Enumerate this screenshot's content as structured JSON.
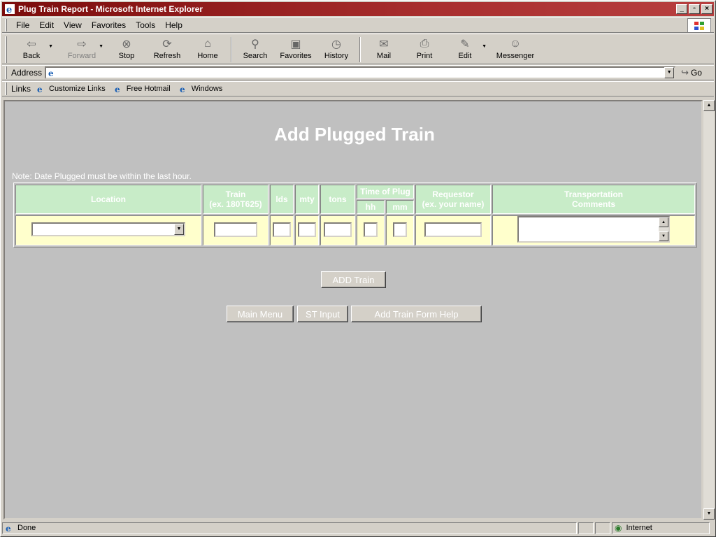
{
  "window": {
    "title": "Plug Train Report - Microsoft Internet Explorer",
    "minimize": "_",
    "maximize": "▫",
    "close": "×"
  },
  "menu": {
    "items": [
      {
        "label": "File"
      },
      {
        "label": "Edit"
      },
      {
        "label": "View"
      },
      {
        "label": "Favorites"
      },
      {
        "label": "Tools"
      },
      {
        "label": "Help"
      }
    ]
  },
  "toolbar": {
    "back": "Back",
    "forward": "Forward",
    "stop": "Stop",
    "refresh": "Refresh",
    "home": "Home",
    "search": "Search",
    "favorites": "Favorites",
    "history": "History",
    "mail": "Mail",
    "print": "Print",
    "edit": "Edit",
    "messenger": "Messenger"
  },
  "address": {
    "label": "Address",
    "value": "",
    "go": "Go"
  },
  "links": {
    "label": "Links",
    "items": [
      {
        "label": "Customize Links"
      },
      {
        "label": "Free Hotmail"
      },
      {
        "label": "Windows"
      }
    ]
  },
  "page": {
    "title": "Add Plugged Train",
    "note": "Note: Date Plugged must be within the last hour.",
    "table": {
      "location": "Location",
      "train": "Train",
      "train_hint": "(ex. 180T625)",
      "lds": "lds",
      "mty": "mty",
      "tons": "tons",
      "time_of_plug": "Time of Plug",
      "hh": "hh",
      "mm": "mm",
      "requestor": "Requestor",
      "requestor_hint": "(ex. your name)",
      "transportation": "Transportation",
      "comments": "Comments"
    },
    "values": {
      "location": "",
      "train": "",
      "lds": "",
      "mty": "",
      "tons": "",
      "hh": "",
      "mm": "",
      "requestor": "",
      "comments": ""
    },
    "buttons": {
      "add_train": "ADD Train",
      "main_menu": "Main Menu",
      "st_input": "ST Input",
      "help": "Add Train Form Help"
    }
  },
  "status": {
    "text": "Done",
    "zone": "Internet"
  }
}
